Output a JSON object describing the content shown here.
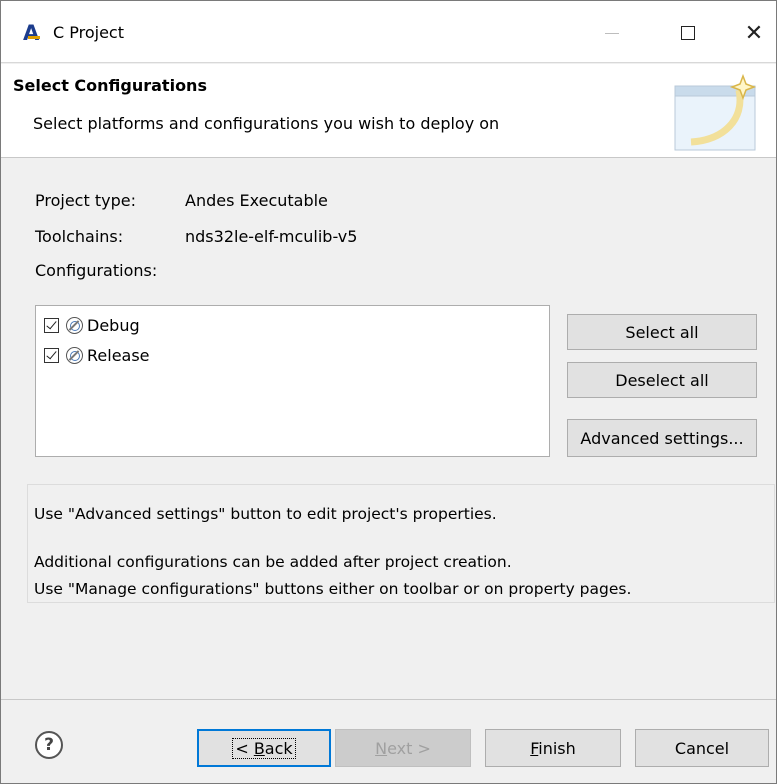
{
  "window": {
    "title": "C Project"
  },
  "banner": {
    "title": "Select Configurations",
    "message": "Select platforms and configurations you wish to deploy on"
  },
  "info": {
    "project_type_label": "Project type:",
    "project_type_value": "Andes Executable",
    "toolchains_label": "Toolchains:",
    "toolchains_value": "nds32le-elf-mculib-v5",
    "configurations_label": "Configurations:"
  },
  "configurations": [
    {
      "label": "Debug",
      "checked": true
    },
    {
      "label": "Release",
      "checked": true
    }
  ],
  "side_buttons": {
    "select_all": "Select all",
    "deselect_all": "Deselect all",
    "advanced_settings": "Advanced settings..."
  },
  "messages": [
    "Use \"Advanced settings\" button to edit project's properties.",
    "Additional configurations can be added after project creation.",
    "Use \"Manage configurations\" buttons either on toolbar or on property pages."
  ],
  "footer": {
    "back_prefix": "< ",
    "back_mnemonic": "B",
    "back_rest": "ack",
    "next_mnemonic": "N",
    "next_rest": "ext >",
    "finish_mnemonic": "F",
    "finish_rest": "inish",
    "cancel": "Cancel"
  },
  "icons": {
    "app": "andes-logo-icon",
    "help": "help-icon",
    "config": "build-config-icon"
  },
  "colors": {
    "accent": "#0078d7",
    "app_icon": "#1c3c8c"
  }
}
